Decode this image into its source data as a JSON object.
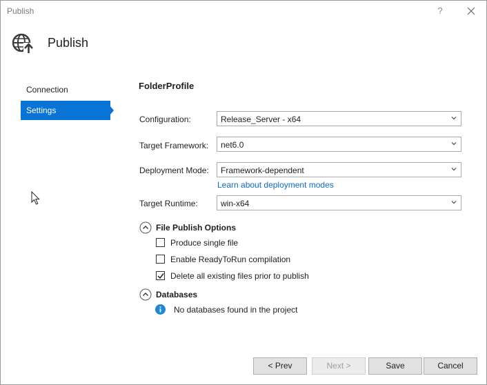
{
  "window": {
    "title": "Publish",
    "help_label": "?",
    "header_title": "Publish",
    "header_icon": "globe-publish-icon"
  },
  "sidebar": {
    "items": [
      {
        "label": "Connection",
        "selected": false
      },
      {
        "label": "Settings",
        "selected": true
      }
    ],
    "accent": "#0a74d6"
  },
  "profile": {
    "name": "FolderProfile"
  },
  "settings": {
    "configuration": {
      "label": "Configuration:",
      "value": "Release_Server - x64"
    },
    "target_framework": {
      "label": "Target Framework:",
      "value": "net6.0"
    },
    "deployment_mode": {
      "label": "Deployment Mode:",
      "value": "Framework-dependent",
      "link": "Learn about deployment modes"
    },
    "target_runtime": {
      "label": "Target Runtime:",
      "value": "win-x64"
    }
  },
  "file_publish_options": {
    "title": "File Publish Options",
    "expanded": true,
    "options": [
      {
        "label": "Produce single file",
        "checked": false
      },
      {
        "label": "Enable ReadyToRun compilation",
        "checked": false
      },
      {
        "label": "Delete all existing files prior to publish",
        "checked": true
      }
    ]
  },
  "databases": {
    "title": "Databases",
    "expanded": true,
    "message": "No databases found in the project",
    "message_icon": "info-icon"
  },
  "buttons": {
    "prev": "< Prev",
    "next": "Next >",
    "save": "Save",
    "cancel": "Cancel"
  },
  "colors": {
    "link": "#0e6ac7",
    "info": "#1e88d6"
  }
}
